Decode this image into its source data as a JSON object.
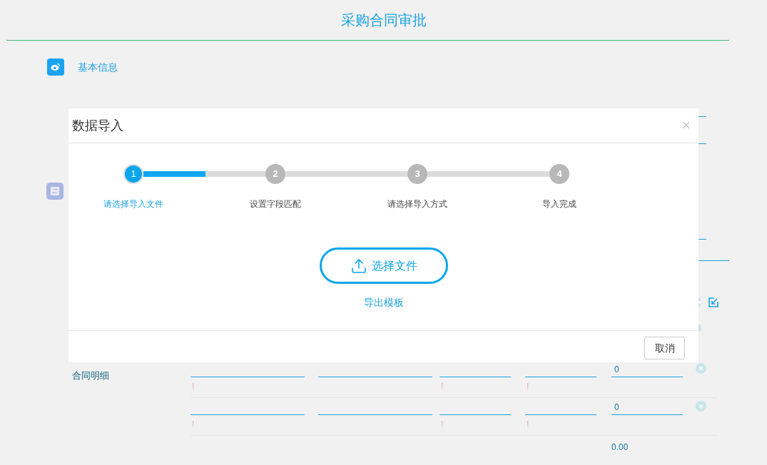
{
  "page": {
    "title": "采购合同审批"
  },
  "basic_section": {
    "label": "基本信息"
  },
  "dialog": {
    "title": "数据导入",
    "close": "×",
    "steps": [
      {
        "number": "1",
        "label": "请选择导入文件",
        "selected": true
      },
      {
        "number": "2",
        "label": "设置字段匹配",
        "selected": false
      },
      {
        "number": "3",
        "label": "请选择导入方式",
        "selected": false
      },
      {
        "number": "4",
        "label": "导入完成",
        "selected": false
      }
    ],
    "progress": {
      "level": 0.51
    },
    "upload_button": "选择文件",
    "template_link": "导出模板",
    "cancel_button": "取消"
  },
  "detail_section": {
    "label": "合同明细",
    "rows": [
      {
        "cells": [
          {
            "kind": "input",
            "hint": "!"
          },
          {
            "kind": "input"
          },
          {
            "kind": "input",
            "hint": "!"
          },
          {
            "kind": "input",
            "hint": "!"
          },
          {
            "kind": "input",
            "value": "0"
          }
        ]
      },
      {
        "cells": [
          {
            "kind": "input",
            "hint": "!"
          },
          {
            "kind": "input"
          },
          {
            "kind": "input",
            "hint": "!"
          },
          {
            "kind": "input",
            "hint": "!"
          },
          {
            "kind": "input",
            "value": "0"
          }
        ]
      }
    ],
    "total": "0.00"
  }
}
